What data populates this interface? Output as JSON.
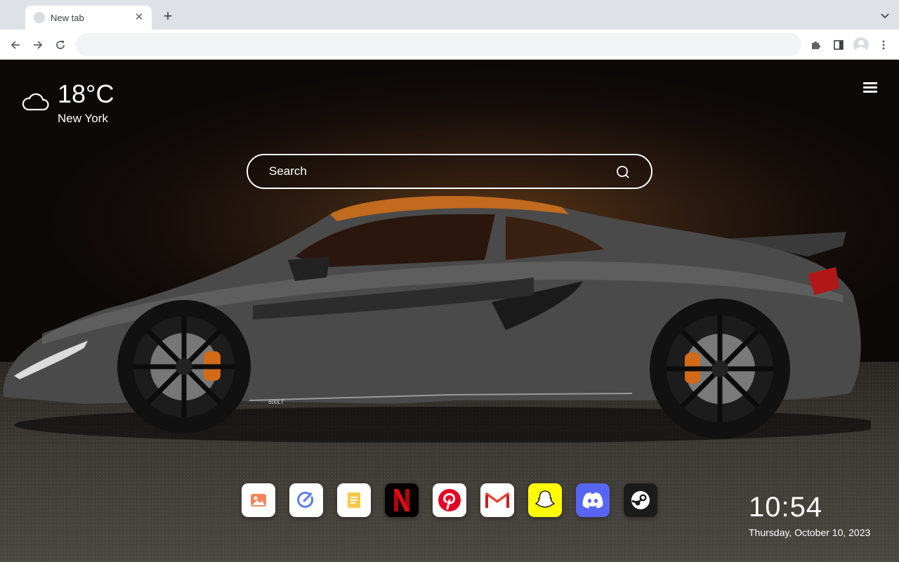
{
  "browser": {
    "tab_title": "New tab",
    "omnibox_value": "",
    "icons": [
      "back-arrow-icon",
      "forward-arrow-icon",
      "reload-icon",
      "extensions-puzzle-icon",
      "side-panel-icon",
      "profile-avatar-icon",
      "kebab-menu-icon"
    ]
  },
  "weather": {
    "temperature": "18°C",
    "city": "New York",
    "icon": "cloud-icon"
  },
  "search": {
    "placeholder": "Search"
  },
  "apps": [
    {
      "name": "Photos",
      "icon": "photos-icon",
      "bg": "#ffffff"
    },
    {
      "name": "Tasks",
      "icon": "tasks-icon",
      "bg": "#ffffff"
    },
    {
      "name": "Notes",
      "icon": "notes-icon",
      "bg": "#ffffff"
    },
    {
      "name": "Netflix",
      "icon": "netflix-icon",
      "bg": "#000000"
    },
    {
      "name": "Pinterest",
      "icon": "pinterest-icon",
      "bg": "#ffffff"
    },
    {
      "name": "Gmail",
      "icon": "gmail-icon",
      "bg": "#ffffff"
    },
    {
      "name": "Snapchat",
      "icon": "snapchat-icon",
      "bg": "#fffc00"
    },
    {
      "name": "Discord",
      "icon": "discord-icon",
      "bg": "#5865f2"
    },
    {
      "name": "Steam",
      "icon": "steam-icon",
      "bg": "#1b1b1b"
    }
  ],
  "clock": {
    "time": "10:54",
    "date": "Thursday, October 10, 2023"
  },
  "background": {
    "subject": "grey sports car",
    "car_badge": "600LT"
  }
}
